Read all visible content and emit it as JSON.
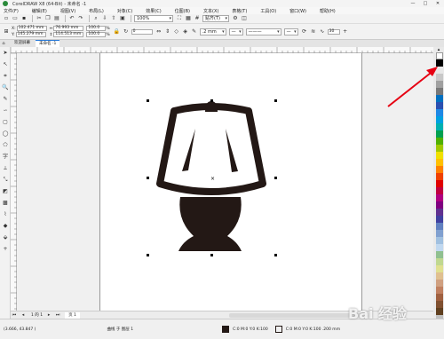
{
  "window": {
    "title": "CorelDRAW X8 (64-Bit) - 未命名 -1",
    "controls": [
      "—",
      "□",
      "✕"
    ]
  },
  "menu": [
    "文件(F)",
    "编辑(E)",
    "视图(V)",
    "布局(L)",
    "对象(C)",
    "效果(C)",
    "位图(B)",
    "文本(X)",
    "表格(T)",
    "工具(O)",
    "窗口(W)",
    "帮助(H)"
  ],
  "toolbar": {
    "zoom": "100%",
    "snap": "贴齐(T)"
  },
  "props": {
    "x": "102.471 mm",
    "y": "145.279 mm",
    "w": "76.993 mm",
    "h": "114.513 mm",
    "sx": "100.0",
    "sy": "100.0",
    "pct": "%",
    "angle": "0",
    "outline": ".2 mm",
    "val": "30"
  },
  "tabs": [
    "欢迎屏幕",
    "未命名 -1"
  ],
  "docnav": {
    "page_of": "1 的 1",
    "page_tab": "页 1"
  },
  "status": {
    "coords": "(3.666, 43.847 )",
    "layer": "曲线 于 图层 1",
    "fill": "C:0 M:0 Y:0 K:100",
    "outline": "C:0 M:0 Y:0 K:100  .200 mm"
  },
  "watermark": "Bai 经验",
  "palette_colors": [
    "#ffffff",
    "#000000",
    "#e8e8e8",
    "#c8c8c8",
    "#a0a0a0",
    "#787878",
    "#0070c0",
    "#2a4fb0",
    "#1e88e5",
    "#00a0e0",
    "#00b0b0",
    "#00a050",
    "#50b000",
    "#a0c800",
    "#f0e000",
    "#ffc000",
    "#ff8000",
    "#f04000",
    "#e00000",
    "#c00040",
    "#b00080",
    "#800080",
    "#603090",
    "#4040a0",
    "#6080c0",
    "#80a0d0",
    "#a0c0e0",
    "#c0d8f0",
    "#90c090",
    "#c0d890",
    "#e0e090",
    "#e0c090",
    "#d0a080",
    "#c08060",
    "#a06040",
    "#805030",
    "#604020",
    "#c0c0c0",
    "#909090",
    "#606060"
  ]
}
